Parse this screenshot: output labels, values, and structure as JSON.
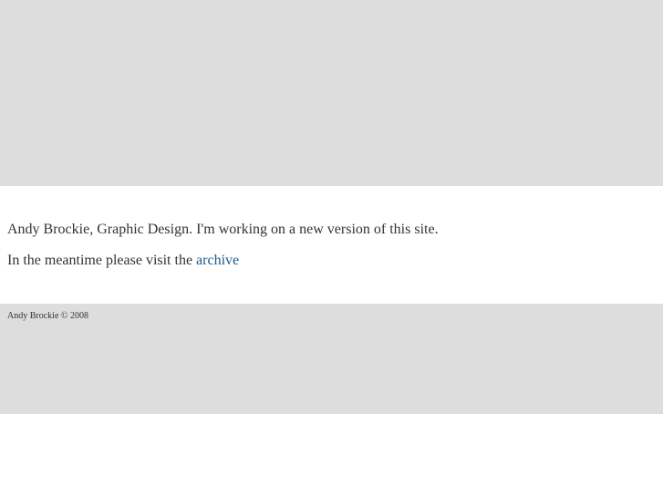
{
  "main": {
    "intro_text": "Andy Brockie, Graphic Design. I'm working on a new version of this site.",
    "meantime_prefix": "In the meantime please visit the ",
    "archive_link": "archive"
  },
  "footer": {
    "copyright": "Andy Brockie © 2008"
  },
  "colors": {
    "band": "#dddddd",
    "text": "#333333",
    "link": "#1c5a8a"
  }
}
